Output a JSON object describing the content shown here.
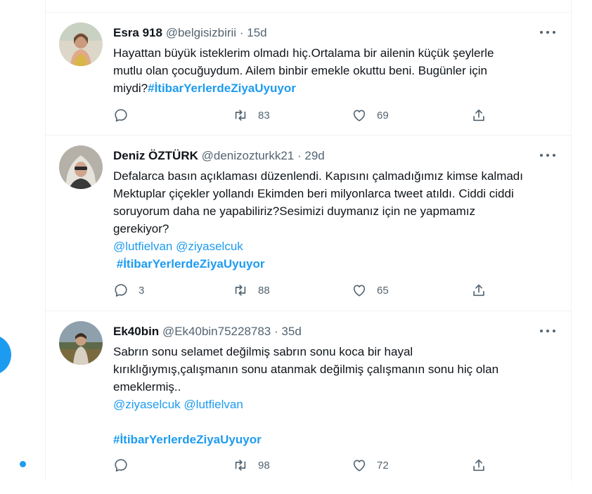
{
  "tweets": [
    {
      "name": "Esra 918",
      "handle": "@belgisizbirii",
      "sep": "·",
      "time": "15d",
      "avatar_icon": "profile-photo",
      "lines": [
        "Hayattan büyük isteklerim olmadı hiç.Ortalama bir ailenin küçük şeylerle",
        "mutlu olan çocuğuydum. Ailem binbir emekle okuttu beni. Bugünler için"
      ],
      "last_line_text": "miydi?",
      "last_line_tag": "#İtibarYerlerdeZiyaUyuyor",
      "reply_count": "",
      "retweet_count": "83",
      "like_count": "69"
    },
    {
      "name": "Deniz ÖZTÜRK",
      "handle": "@denizozturkk21",
      "sep": "·",
      "time": "29d",
      "avatar_icon": "profile-photo",
      "lines": [
        "Defalarca basın açıklaması düzenlendi. Kapısını çalmadığımız kimse kalmadı",
        "Mektuplar çiçekler yollandı Ekimden beri milyonlarca tweet atıldı. Ciddi ciddi",
        "soruyorum daha ne yapabiliriz?Sesimizi duymanız için ne yapmamız",
        "gerekiyor?"
      ],
      "mention1": "@lutfielvan",
      "mention2": "@ziyaselcuk",
      "hashtag": "#İtibarYerlerdeZiyaUyuyor",
      "reply_count": "3",
      "retweet_count": "88",
      "like_count": "65"
    },
    {
      "name": "Ek40bin",
      "handle": "@Ek40bin75228783",
      "sep": "·",
      "time": "35d",
      "avatar_icon": "profile-photo",
      "lines": [
        "Sabrın sonu selamet değilmiş sabrın sonu koca bir hayal",
        "kırıklığıymış,çalışmanın sonu atanmak değilmiş çalışmanın sonu hiç olan",
        "emeklermiş.."
      ],
      "mention1": "@ziyaselcuk",
      "mention2": "@lutfielvan",
      "hashtag": "#İtibarYerlerdeZiyaUyuyor",
      "reply_count": "",
      "retweet_count": "98",
      "like_count": "72"
    }
  ],
  "colors": {
    "accent": "#1d9bf0",
    "text": "#0f1419",
    "secondary": "#536471",
    "border": "#eff3f4"
  }
}
